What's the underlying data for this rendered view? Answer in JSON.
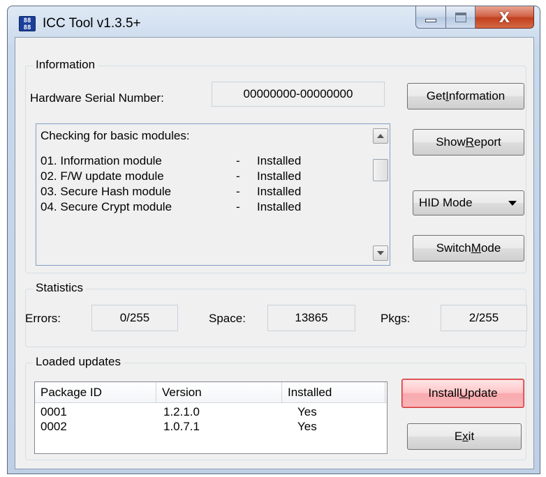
{
  "window": {
    "title": "ICC Tool v1.3.5+",
    "icon": "app-icon",
    "icon_text": "88\n88"
  },
  "information": {
    "group_label": "Information",
    "serial_label": "Hardware Serial Number:",
    "serial_value": "00000000-00000000",
    "get_information_label": "Get Information",
    "show_report_label": "Show Report",
    "mode_selected": "HID Mode",
    "switch_mode_label": "Switch Mode",
    "modules_header": "Checking for basic modules:",
    "modules": [
      {
        "name": "01. Information module",
        "dash": "-",
        "status": "Installed"
      },
      {
        "name": "02. F/W update module",
        "dash": "-",
        "status": "Installed"
      },
      {
        "name": "03. Secure Hash module",
        "dash": "-",
        "status": "Installed"
      },
      {
        "name": "04. Secure Crypt module",
        "dash": "-",
        "status": "Installed"
      }
    ]
  },
  "statistics": {
    "group_label": "Statistics",
    "errors_label": "Errors:",
    "errors_value": "0/255",
    "space_label": "Space:",
    "space_value": "13865",
    "pkgs_label": "Pkgs:",
    "pkgs_value": "2/255"
  },
  "updates": {
    "group_label": "Loaded updates",
    "columns": [
      "Package ID",
      "Version",
      "Installed"
    ],
    "rows": [
      {
        "id": "0001",
        "version": "1.2.1.0",
        "installed": "Yes"
      },
      {
        "id": "0002",
        "version": "1.0.7.1",
        "installed": "Yes"
      }
    ],
    "install_update_label": "Install Update",
    "exit_label": "Exit"
  },
  "colors": {
    "accent_button": "#f9a9ad",
    "close_button": "#c0401f"
  }
}
